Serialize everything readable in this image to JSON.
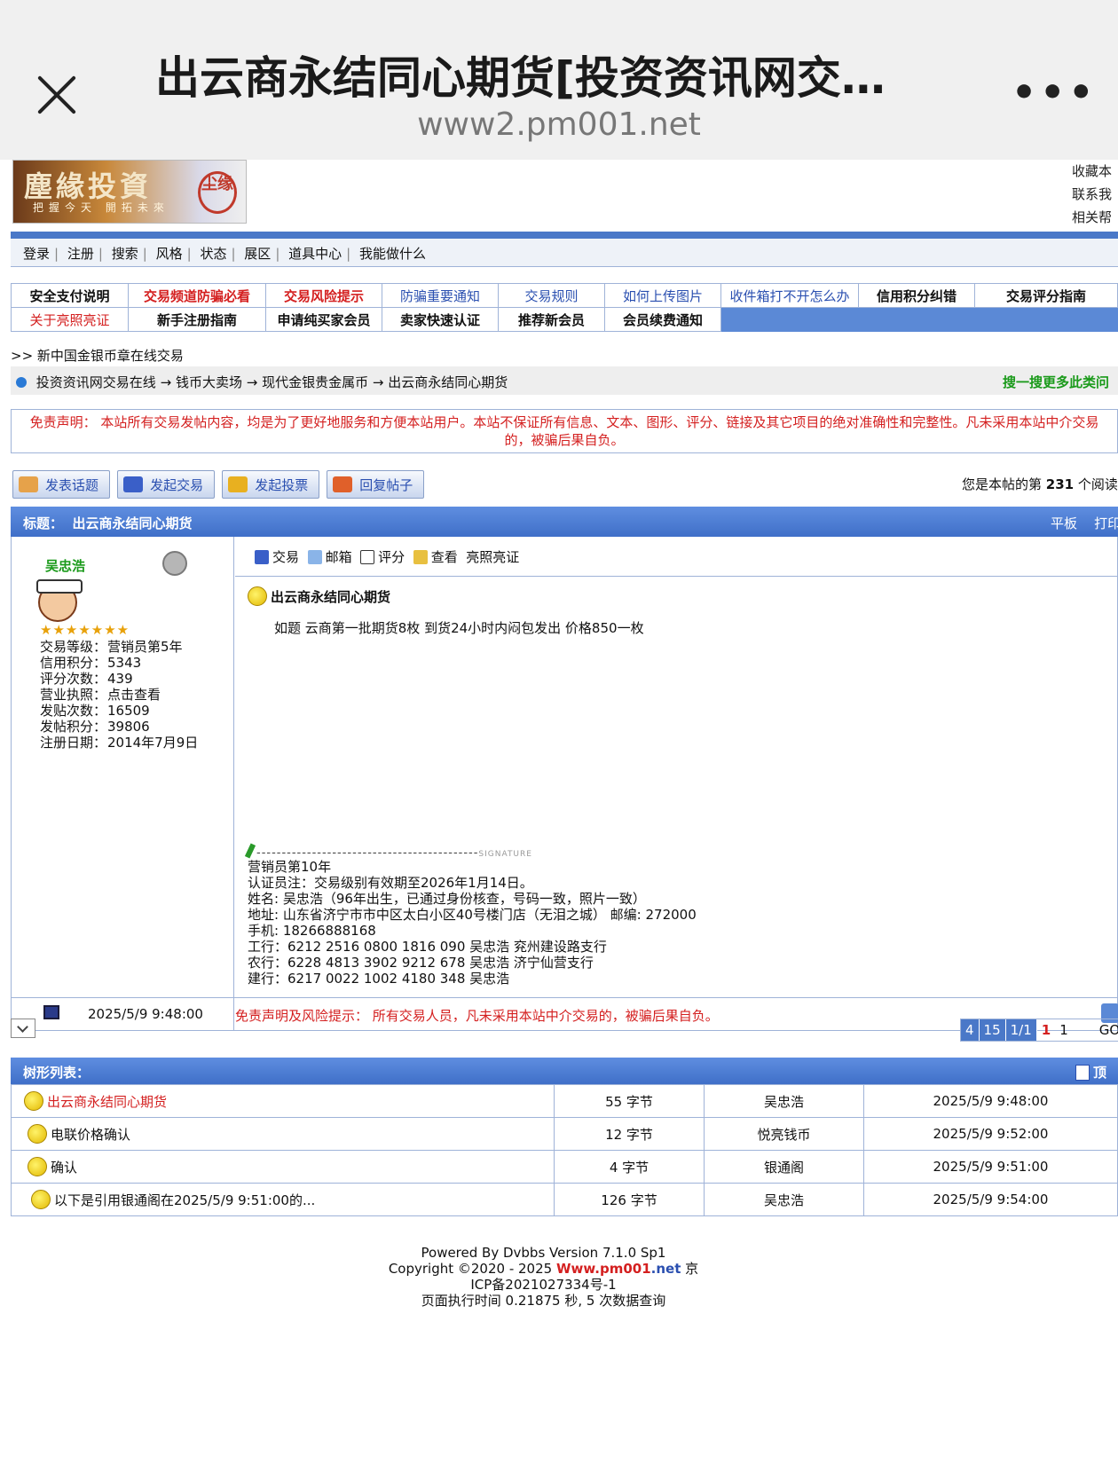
{
  "browser": {
    "title": "出云商永结同心期货[投资资讯网交…",
    "url": "www2.pm001.net"
  },
  "logo": {
    "title": "塵緣投資",
    "slogan": "把握今天 開拓未來",
    "seal": "尘缘"
  },
  "top_links": [
    "收藏本",
    "联系我",
    "相关帮"
  ],
  "menu": [
    "登录",
    "注册",
    "搜索",
    "风格",
    "状态",
    "展区",
    "道具中心",
    "我能做什么"
  ],
  "notice_grid": {
    "row1": [
      "安全支付说明",
      "交易频道防骗必看",
      "交易风险提示",
      "防骗重要通知",
      "交易规则",
      "如何上传图片",
      "收件箱打不开怎么办",
      "信用积分纠错",
      "交易评分指南"
    ],
    "row2": [
      "关于亮照亮证",
      "新手注册指南",
      "申请纯买家会员",
      "卖家快速认证",
      "推荐新会员",
      "会员续费通知"
    ]
  },
  "breadcrumb_top": ">> 新中国金银币章在线交易",
  "breadcrumb": [
    "投资资讯网交易在线",
    "钱币大卖场",
    "现代金银贵金属币",
    "出云商永结同心期货"
  ],
  "breadcrumb_arrow": "→",
  "search_more": "搜一搜更多此类问",
  "disclaimer": "免责声明：  本站所有交易发帖内容，均是为了更好地服务和方便本站用户。本站不保证所有信息、文本、图形、评分、链接及其它项目的绝对准确性和完整性。凡未采用本站中介交易的，被骗后果自负。",
  "action_buttons": [
    "发表话题",
    "发起交易",
    "发起投票",
    "回复帖子"
  ],
  "read_count": {
    "prefix": "您是本帖的第",
    "count": "231",
    "suffix": "个阅读"
  },
  "post_title_bar": {
    "label": "标题：",
    "title": "出云商永结同心期货",
    "right1": "平板",
    "right2": "打印"
  },
  "author": {
    "name": "吴忠浩",
    "stars": "★★★★★★★",
    "info": [
      {
        "k": "交易等级：",
        "v": "营销员第5年"
      },
      {
        "k": "信用积分：",
        "v": "5343"
      },
      {
        "k": "评分次数：",
        "v": "439"
      },
      {
        "k": "营业执照：",
        "v": "点击查看"
      },
      {
        "k": "发贴次数：",
        "v": "16509"
      },
      {
        "k": "发帖积分：",
        "v": "39806"
      },
      {
        "k": "注册日期：",
        "v": "2014年7月9日"
      }
    ]
  },
  "post_tools": [
    "交易",
    "邮箱",
    "评分",
    "查看",
    "亮照亮证"
  ],
  "post": {
    "title": "出云商永结同心期货",
    "body": "如题 云商第一批期货8枚 到货24小时内闷包发出 价格850一枚",
    "sig_dashes": "--------------------------------------------",
    "sig_mark": "SIGNATURE",
    "signature": [
      "营销员第10年",
      "认证员注：交易级别有效期至2026年1月14日。",
      "姓名: 吴忠浩（96年出生，已通过身份核查，号码一致，照片一致）",
      "地址: 山东省济宁市市中区太白小区40号楼门店（无泪之城） 邮编: 272000",
      "手机: 18266888168",
      "工行：6212 2516 0800 1816 090  吴忠浩 兖州建设路支行",
      "农行：6228 4813 3902 9212 678  吴忠浩 济宁仙营支行",
      "建行：6217 0022 1002 4180 348  吴忠浩"
    ],
    "date": "2025/5/9 9:48:00",
    "footer_notice": "免责声明及风险提示：  所有交易人员，凡未采用本站中介交易的，被骗后果自负。"
  },
  "pager": {
    "cells": [
      "4",
      "15",
      "1/1"
    ],
    "current": "1",
    "next": "1",
    "go": "GO"
  },
  "tree": {
    "label": "树形列表：",
    "right": "顶",
    "rows": [
      {
        "title": "出云商永结同心期货",
        "size": "55 字节",
        "author": "吴忠浩",
        "date": "2025/5/9 9:48:00"
      },
      {
        "title": "电联价格确认",
        "size": "12 字节",
        "author": "悦亮钱币",
        "date": "2025/5/9 9:52:00"
      },
      {
        "title": "确认",
        "size": "4 字节",
        "author": "银通阁",
        "date": "2025/5/9 9:51:00"
      },
      {
        "title": "以下是引用银通阁在2025/5/9 9:51:00的...",
        "size": "126 字节",
        "author": "吴忠浩",
        "date": "2025/5/9 9:54:00"
      }
    ]
  },
  "footer": {
    "line1": "Powered By Dvbbs Version 7.1.0 Sp1",
    "copy": "Copyright ©2020 - 2025",
    "brand1": "Www.pm001",
    "brand2": ".net",
    "line2b": "京",
    "line3": "ICP备2021027334号-1",
    "line4": "页面执行时间 0.21875 秒, 5 次数据查询"
  }
}
